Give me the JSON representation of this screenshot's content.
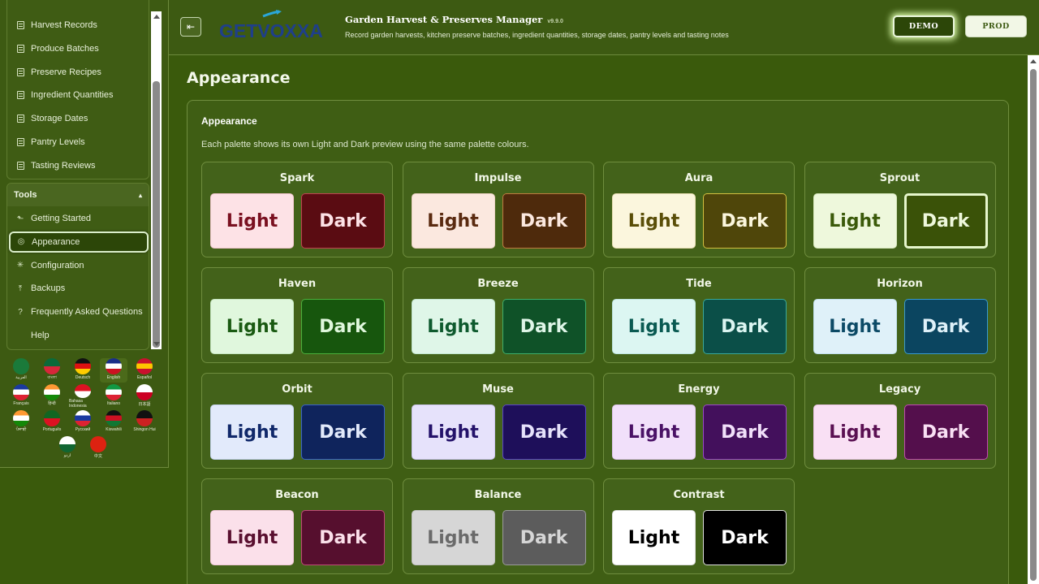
{
  "sidebar": {
    "top_items": [
      {
        "label": "Harvest Records",
        "icon": "document-icon"
      },
      {
        "label": "Produce Batches",
        "icon": "document-icon"
      },
      {
        "label": "Preserve Recipes",
        "icon": "document-icon"
      },
      {
        "label": "Ingredient Quantities",
        "icon": "document-icon"
      },
      {
        "label": "Storage Dates",
        "icon": "document-icon"
      },
      {
        "label": "Pantry Levels",
        "icon": "document-icon"
      },
      {
        "label": "Tasting Reviews",
        "icon": "document-icon"
      }
    ],
    "tools": {
      "header": "Tools",
      "toggle": "▴",
      "items": [
        {
          "label": "Getting Started",
          "icon": "launch-icon",
          "glyph": "⬑"
        },
        {
          "label": "Appearance",
          "icon": "palette-icon",
          "glyph": "◎",
          "active": true
        },
        {
          "label": "Configuration",
          "icon": "gear-icon",
          "glyph": "✳"
        },
        {
          "label": "Backups",
          "icon": "upload-icon",
          "glyph": "⤒"
        },
        {
          "label": "Frequently Asked Questions",
          "icon": "help-circle-icon",
          "glyph": "?"
        },
        {
          "label": "Help",
          "icon": "",
          "glyph": ""
        }
      ]
    },
    "languages": [
      {
        "label": "العربية",
        "colors": [
          "#1a7a3a",
          "#1a7a3a"
        ]
      },
      {
        "label": "বাংলা",
        "colors": [
          "#0a6a3a",
          "#d8263a"
        ]
      },
      {
        "label": "Deutsch",
        "colors": [
          "#111111",
          "#dd1111",
          "#ffcc00"
        ]
      },
      {
        "label": "English",
        "colors": [
          "#1a2f8a",
          "#ffffff",
          "#cc1122"
        ],
        "selected": true
      },
      {
        "label": "Español",
        "colors": [
          "#c8102e",
          "#ffc400",
          "#c8102e"
        ]
      },
      {
        "label": "Français",
        "colors": [
          "#1a3aa0",
          "#ffffff",
          "#dd2233"
        ]
      },
      {
        "label": "हिन्दी",
        "colors": [
          "#ff9933",
          "#ffffff",
          "#138808"
        ]
      },
      {
        "label": "Bahasa Indonesia",
        "colors": [
          "#dd1122",
          "#ffffff"
        ]
      },
      {
        "label": "Italiano",
        "colors": [
          "#119944",
          "#ffffff",
          "#dd2233"
        ]
      },
      {
        "label": "日本語",
        "colors": [
          "#ffffff",
          "#cc0022"
        ]
      },
      {
        "label": "ਪੰਜਾਬੀ",
        "colors": [
          "#ff9933",
          "#ffffff",
          "#138808"
        ]
      },
      {
        "label": "Português",
        "colors": [
          "#116622",
          "#dd1122"
        ]
      },
      {
        "label": "Русский",
        "colors": [
          "#ffffff",
          "#1a3aa0",
          "#dd2233"
        ]
      },
      {
        "label": "Kiswahili",
        "colors": [
          "#111111",
          "#cc1122",
          "#117733"
        ]
      },
      {
        "label": "Shingon Hui",
        "colors": [
          "#111111",
          "#cc2222"
        ]
      },
      {
        "label": "اردو",
        "colors": [
          "#ffffff",
          "#116633"
        ]
      },
      {
        "label": "中文",
        "colors": [
          "#dd2211",
          "#dd2211"
        ]
      }
    ]
  },
  "header": {
    "logo_text": "GETVOXXA",
    "title": "Garden Harvest & Preserves Manager",
    "version": "v9.9.0",
    "subtitle": "Record garden harvests, kitchen preserve batches, ingredient quantities, storage dates, pantry levels and tasting notes",
    "demo_label": "DEMO",
    "prod_label": "PROD",
    "collapse_icon": "⇤"
  },
  "page": {
    "title": "Appearance",
    "card_title": "Appearance",
    "card_desc": "Each palette shows its own Light and Dark preview using the same palette colours."
  },
  "palettes": [
    {
      "name": "Spark",
      "light": {
        "label": "Light",
        "bg": "#fde2e6",
        "fg": "#7a1020",
        "border": "#f0c5cc"
      },
      "dark": {
        "label": "Dark",
        "bg": "#5a0c12",
        "fg": "#fde2e6",
        "border": "#c04050"
      }
    },
    {
      "name": "Impulse",
      "light": {
        "label": "Light",
        "bg": "#fbe8df",
        "fg": "#5a2a10",
        "border": "#ecd2c4"
      },
      "dark": {
        "label": "Dark",
        "bg": "#4e2a0c",
        "fg": "#fbe8df",
        "border": "#c07a40"
      }
    },
    {
      "name": "Aura",
      "light": {
        "label": "Light",
        "bg": "#fbf6dd",
        "fg": "#5a4e08",
        "border": "#e8dfb4"
      },
      "dark": {
        "label": "Dark",
        "bg": "#4f460a",
        "fg": "#fbf6dd",
        "border": "#d3bf40"
      }
    },
    {
      "name": "Sprout",
      "light": {
        "label": "Light",
        "bg": "#eef8dc",
        "fg": "#3b5a0a",
        "border": "#d7e8bd"
      },
      "dark": {
        "label": "Dark",
        "bg": "#3a5208",
        "fg": "#eef8dc",
        "border": "#e6f6cc",
        "selected": true
      }
    },
    {
      "name": "Haven",
      "light": {
        "label": "Light",
        "bg": "#e0f7dd",
        "fg": "#1a5a12",
        "border": "#c5e6c0"
      },
      "dark": {
        "label": "Dark",
        "bg": "#17560d",
        "fg": "#e0f7dd",
        "border": "#4caf3c"
      }
    },
    {
      "name": "Breeze",
      "light": {
        "label": "Light",
        "bg": "#dff6e8",
        "fg": "#0e5a2e",
        "border": "#c2e6cf"
      },
      "dark": {
        "label": "Dark",
        "bg": "#0f5228",
        "fg": "#dff6e8",
        "border": "#3fae6a"
      }
    },
    {
      "name": "Tide",
      "light": {
        "label": "Light",
        "bg": "#dcf6f2",
        "fg": "#0a5a52",
        "border": "#bee5df"
      },
      "dark": {
        "label": "Dark",
        "bg": "#0b4f48",
        "fg": "#dcf6f2",
        "border": "#3aa89a"
      }
    },
    {
      "name": "Horizon",
      "light": {
        "label": "Light",
        "bg": "#dff1f9",
        "fg": "#0c4a66",
        "border": "#c0dfec"
      },
      "dark": {
        "label": "Dark",
        "bg": "#0b4560",
        "fg": "#dff1f9",
        "border": "#3a9acc"
      }
    },
    {
      "name": "Orbit",
      "light": {
        "label": "Light",
        "bg": "#e2eafb",
        "fg": "#10286a",
        "border": "#c6d3f0"
      },
      "dark": {
        "label": "Dark",
        "bg": "#0f245c",
        "fg": "#e2eafb",
        "border": "#3a62c8"
      }
    },
    {
      "name": "Muse",
      "light": {
        "label": "Light",
        "bg": "#e6e2fb",
        "fg": "#24126a",
        "border": "#cdc6f0"
      },
      "dark": {
        "label": "Dark",
        "bg": "#1e0f5a",
        "fg": "#e6e2fb",
        "border": "#5a44c8"
      }
    },
    {
      "name": "Energy",
      "light": {
        "label": "Light",
        "bg": "#f1e0fa",
        "fg": "#4a1266",
        "border": "#e0c6ee"
      },
      "dark": {
        "label": "Dark",
        "bg": "#43105c",
        "fg": "#f1e0fa",
        "border": "#9a48c8"
      }
    },
    {
      "name": "Legacy",
      "light": {
        "label": "Light",
        "bg": "#f9e0f4",
        "fg": "#5a1052",
        "border": "#ecc6e6"
      },
      "dark": {
        "label": "Dark",
        "bg": "#540f4c",
        "fg": "#f9e0f4",
        "border": "#c048b0"
      }
    },
    {
      "name": "Beacon",
      "light": {
        "label": "Light",
        "bg": "#fbe0ea",
        "fg": "#5a1030",
        "border": "#efc6d6"
      },
      "dark": {
        "label": "Dark",
        "bg": "#560f2e",
        "fg": "#fbe0ea",
        "border": "#c04878"
      }
    },
    {
      "name": "Balance",
      "light": {
        "label": "Light",
        "bg": "#d6d6d6",
        "fg": "#6a6a6a",
        "border": "#c2c2c2"
      },
      "dark": {
        "label": "Dark",
        "bg": "#5c5c5c",
        "fg": "#d6d6d6",
        "border": "#9a9a9a"
      }
    },
    {
      "name": "Contrast",
      "light": {
        "label": "Light",
        "bg": "#ffffff",
        "fg": "#000000",
        "border": "#dddddd"
      },
      "dark": {
        "label": "Dark",
        "bg": "#000000",
        "fg": "#ffffff",
        "border": "#dddddd"
      }
    }
  ]
}
